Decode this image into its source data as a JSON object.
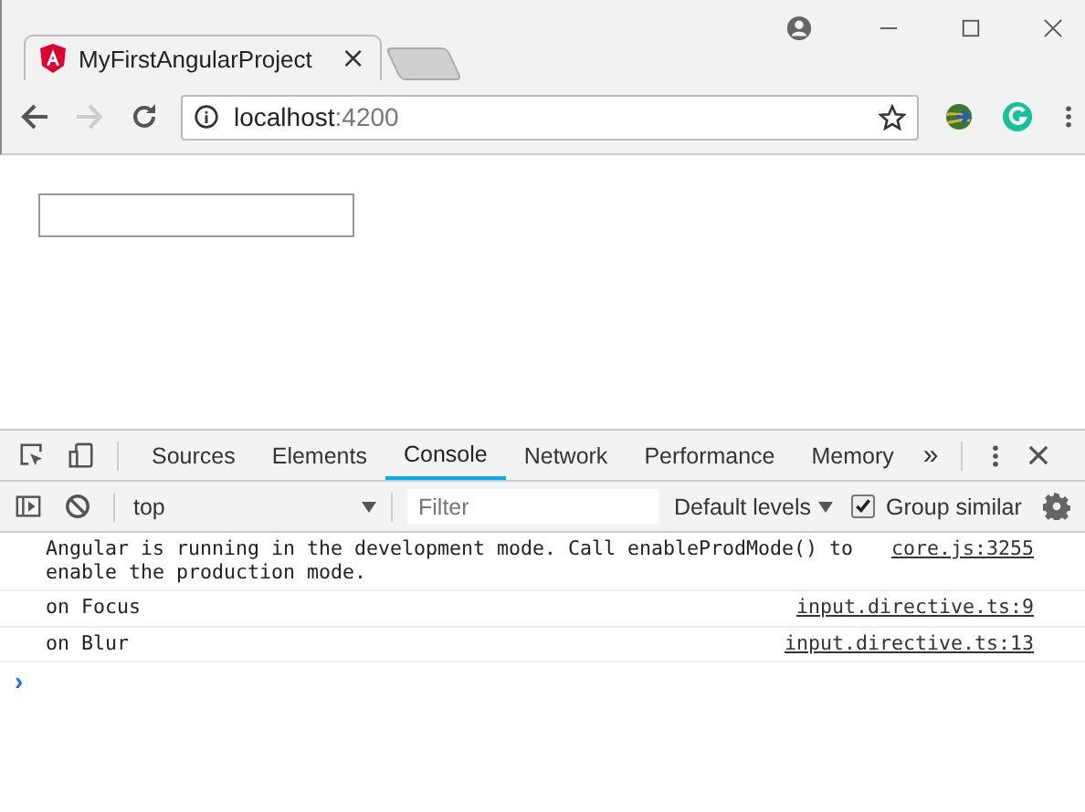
{
  "browser_tab": {
    "title": "MyFirstAngularProject",
    "close": "×"
  },
  "address_bar": {
    "host": "localhost",
    "port": ":4200"
  },
  "devtools": {
    "tabs": [
      {
        "label": "Sources",
        "selected": false
      },
      {
        "label": "Elements",
        "selected": false
      },
      {
        "label": "Console",
        "selected": true
      },
      {
        "label": "Network",
        "selected": false
      },
      {
        "label": "Performance",
        "selected": false
      },
      {
        "label": "Memory",
        "selected": false
      }
    ],
    "more_tabs": "»",
    "toolbar": {
      "context": "top",
      "filter_placeholder": "Filter",
      "levels": "Default levels",
      "group_similar": {
        "label": "Group similar",
        "checked": true
      }
    },
    "messages": [
      {
        "text": "Angular is running in the development mode. Call enableProdMode() to enable the production mode.",
        "source": "core.js:3255"
      },
      {
        "text": "on Focus",
        "source": "input.directive.ts:9"
      },
      {
        "text": "on Blur",
        "source": "input.directive.ts:13"
      }
    ],
    "prompt": "›"
  }
}
